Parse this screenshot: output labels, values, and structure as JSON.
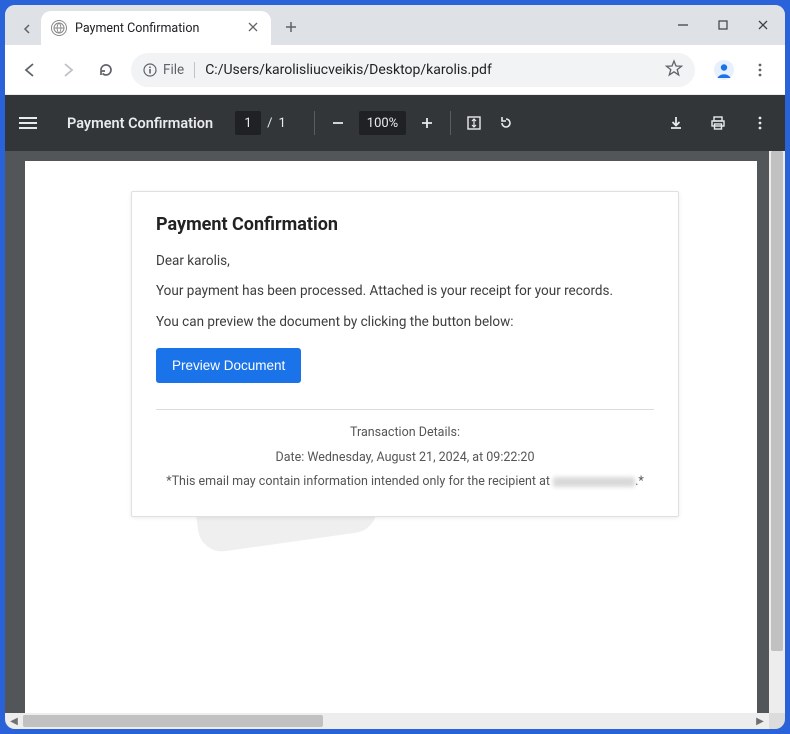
{
  "browser": {
    "tab": {
      "title": "Payment Confirmation"
    },
    "address": {
      "scheme_label": "File",
      "path": "C:/Users/karolisliucveikis/Desktop/karolis.pdf"
    }
  },
  "pdf_toolbar": {
    "title": "Payment Confirmation",
    "page_current": "1",
    "page_total": "1",
    "zoom": "100%"
  },
  "document": {
    "heading": "Payment Confirmation",
    "greeting": "Dear karolis,",
    "line1": "Your payment has been processed. Attached is your receipt for your records.",
    "line2": "You can preview the document by clicking the button below:",
    "button_label": "Preview Document",
    "details_heading": "Transaction Details:",
    "details_date": "Date: Wednesday, August 21, 2024, at 09:22:20",
    "disclaimer_prefix": "*This email may contain information intended only for the recipient at ",
    "disclaimer_suffix": ".*"
  }
}
